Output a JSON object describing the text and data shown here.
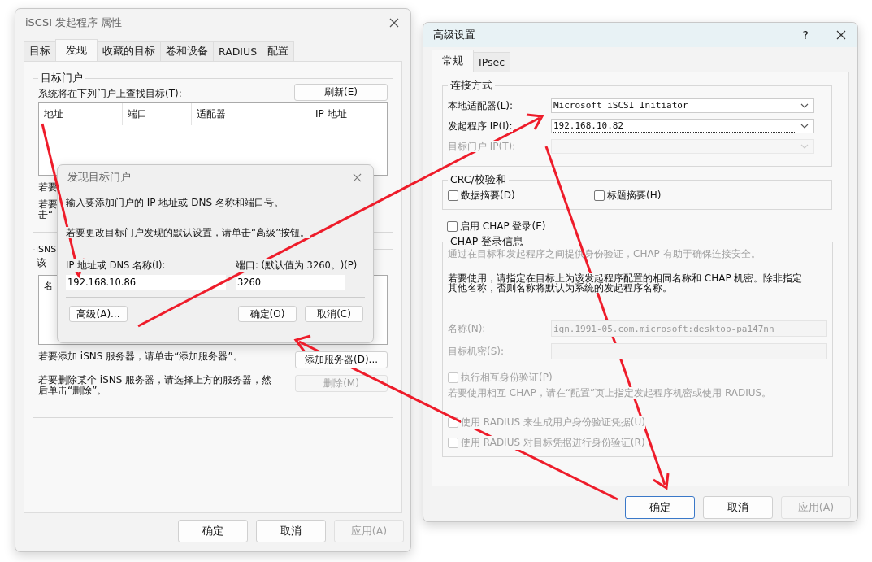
{
  "main_window": {
    "title": "iSCSI 发起程序 属性",
    "tabs": [
      {
        "label": "目标",
        "selected": false
      },
      {
        "label": "发现",
        "selected": true
      },
      {
        "label": "收藏的目标",
        "selected": false
      },
      {
        "label": "卷和设备",
        "selected": false
      },
      {
        "label": "RADIUS",
        "selected": false
      },
      {
        "label": "配置",
        "selected": false
      }
    ],
    "portal_group": {
      "title": "目标门户",
      "caption": "系统将在下列门户上查找目标(T):",
      "refresh_button": "刷新(E)",
      "columns": [
        "地址",
        "端口",
        "适配器",
        "IP 地址"
      ],
      "partial_notes": [
        [
          "若要"
        ],
        [
          "若要",
          "击“"
        ]
      ]
    },
    "isns_group": {
      "title": "iSNS",
      "caption": "该",
      "columns": [
        "名"
      ],
      "add_note": "若要添加 iSNS 服务器，请单击“添加服务器”。",
      "add_button": {
        "label": "添加服务器(D)...",
        "disabled": false
      },
      "remove_note": "若要删除某个 iSNS 服务器，请选择上方的服务器，然后单击“删除”。",
      "remove_button": {
        "label": "删除(M)",
        "disabled": true
      }
    },
    "buttons": [
      {
        "label": "确定",
        "disabled": false
      },
      {
        "label": "取消",
        "disabled": false
      },
      {
        "label": "应用(A)",
        "disabled": true
      }
    ]
  },
  "discover_dialog": {
    "title": "发现目标门户",
    "instruction": "输入要添加门户的 IP 地址或 DNS 名称和端口号。",
    "advanced_note": "若要更改目标门户发现的默认设置，请单击“高级”按钮。",
    "ip_label": "IP 地址或 DNS 名称(I):",
    "ip_value": "192.168.10.86",
    "port_label": "端口: (默认值为 3260。)(P)",
    "port_value": "3260",
    "advanced_button": "高级(A)...",
    "ok_button": "确定(O)",
    "cancel_button": "取消(C)"
  },
  "advanced_window": {
    "title": "高级设置",
    "help": "?",
    "tabs": [
      {
        "label": "常规",
        "selected": true
      },
      {
        "label": "IPsec",
        "selected": false
      }
    ],
    "connection_group": {
      "title": "连接方式",
      "rows": [
        {
          "label": "本地适配器(L):",
          "value": "Microsoft iSCSI Initiator",
          "disabled": false,
          "focused": false
        },
        {
          "label": "发起程序 IP(I):",
          "value": "192.168.10.82",
          "disabled": false,
          "focused": true
        },
        {
          "label": "目标门户 IP(T):",
          "disabled": true,
          "focused": false
        }
      ]
    },
    "crc_group": {
      "title": "CRC/校验和",
      "checkboxes": [
        {
          "label": "数据摘要(D)",
          "checked": false
        },
        {
          "label": "标题摘要(H)",
          "checked": false
        }
      ]
    },
    "chap_checkbox": {
      "label": "启用 CHAP 登录(E)",
      "checked": false
    },
    "chap_group": {
      "title": "CHAP 登录信息",
      "description": "通过在目标和发起程序之间提供身份验证，CHAP 有助于确保连接安全。",
      "instructions": "若要使用，请指定在目标上为该发起程序配置的相同名称和 CHAP 机密。除非指定其他名称，否则名称将默认为系统的发起程序名称。",
      "fields": [
        {
          "label": "名称(N):",
          "value": "iqn.1991-05.com.microsoft:desktop-pa147nn",
          "disabled": true
        },
        {
          "label": "目标机密(S):",
          "disabled": true
        }
      ],
      "mutual_checkbox": {
        "label": "执行相互身份验证(P)",
        "checked": false,
        "disabled": true
      },
      "mutual_note": "若要使用相互 CHAP，请在“配置”页上指定发起程序机密或使用 RADIUS。",
      "radius_checkboxes": [
        {
          "label": "使用 RADIUS 来生成用户身份验证凭据(U)",
          "checked": false,
          "disabled": true
        },
        {
          "label": "使用 RADIUS 对目标凭据进行身份验证(R)",
          "checked": false,
          "disabled": true
        }
      ]
    },
    "buttons": [
      {
        "label": "确定",
        "disabled": false,
        "focused": true
      },
      {
        "label": "取消",
        "disabled": false,
        "focused": false
      },
      {
        "label": "应用(A)",
        "disabled": true,
        "focused": false
      }
    ]
  }
}
